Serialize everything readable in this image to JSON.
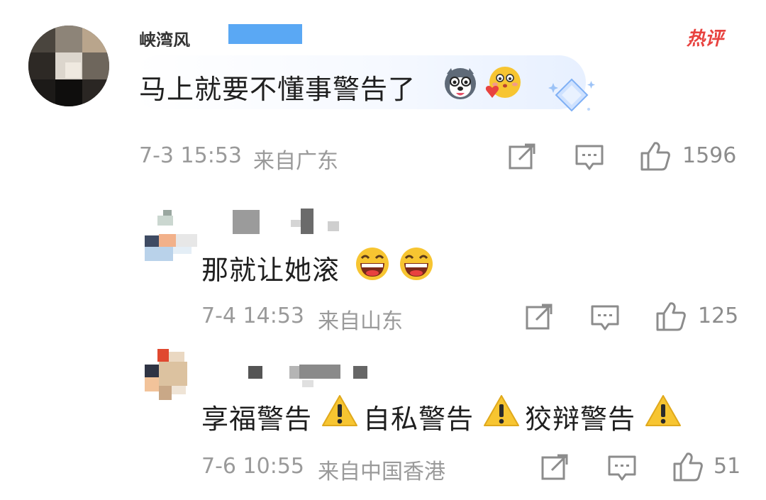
{
  "badge": {
    "label": "热评"
  },
  "comments": [
    {
      "author": "峡湾风",
      "text": "马上就要不懂事警告了",
      "date": "7-3 15:53",
      "location": "来自广东",
      "likes": "1596",
      "emojis": [
        "husky-emoji",
        "heart-blush-emoji"
      ]
    },
    {
      "text": "那就让她滚",
      "date": "7-4 14:53",
      "location": "来自山东",
      "likes": "125",
      "emojis": [
        "laughing-emoji",
        "laughing-emoji"
      ]
    },
    {
      "segments": [
        "享福警告",
        "自私警告",
        "狡辩警告"
      ],
      "date": "7-6 10:55",
      "location": "来自中国香港",
      "likes": "51",
      "emojis": [
        "warning-emoji",
        "warning-emoji",
        "warning-emoji"
      ]
    }
  ],
  "icons": {
    "share": "share-icon",
    "reply": "comment-icon",
    "like": "thumbs-up-icon"
  },
  "colors": {
    "badge_red": "#e8423f",
    "meta_gray": "#9a9a9a",
    "name_blur_blue": "#5aa8f4",
    "emoji_yellow": "#f7c531"
  }
}
